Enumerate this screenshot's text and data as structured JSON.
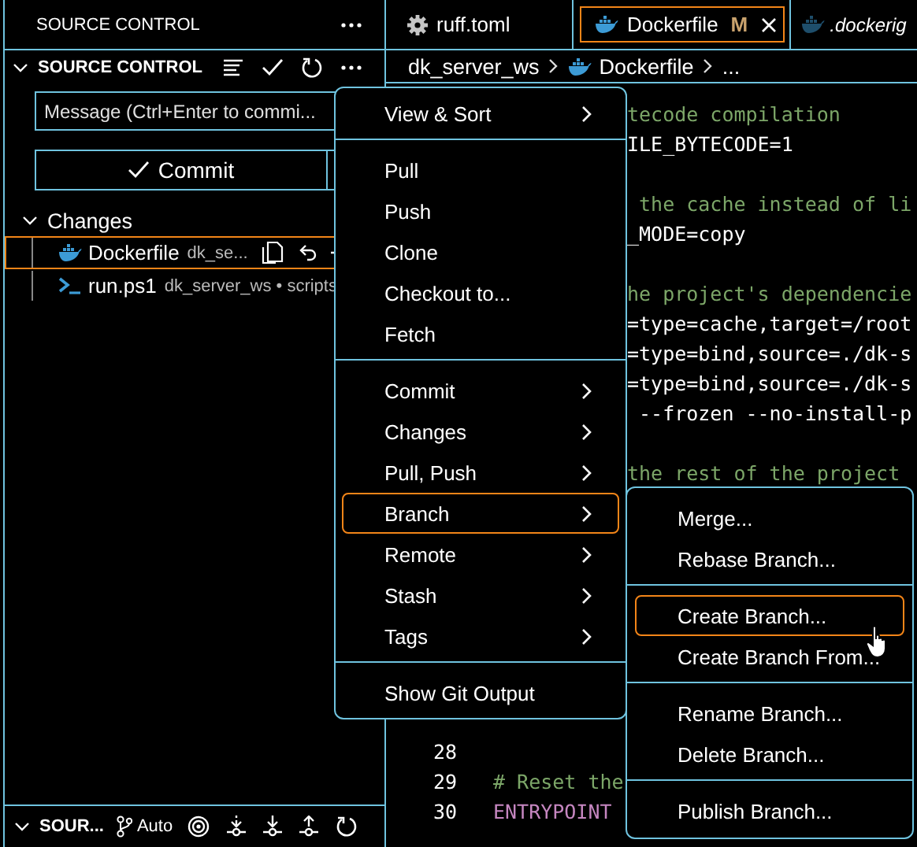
{
  "sidebar": {
    "title": "SOURCE CONTROL",
    "section": {
      "title": "SOURCE CONTROL",
      "expanded": true
    },
    "message": {
      "placeholder": "Message (Ctrl+Enter to commi..."
    },
    "commit_button": "Commit",
    "changes": {
      "label": "Changes",
      "expanded": true,
      "files": [
        {
          "name": "Dockerfile",
          "path": "dk_se...",
          "kind": "docker",
          "selected": true
        },
        {
          "name": "run.ps1",
          "path": "dk_server_ws • scripts",
          "kind": "powershell",
          "selected": false
        }
      ]
    },
    "bottom_section": {
      "title": "SOUR...",
      "expanded": true,
      "branch_mode": "Auto"
    }
  },
  "tabs": [
    {
      "label": "ruff.toml",
      "kind": "settings",
      "selected": false,
      "preview": false
    },
    {
      "label": "Dockerfile",
      "kind": "docker",
      "selected": true,
      "preview": false,
      "badge": "M"
    },
    {
      "label": ".dockerig",
      "kind": "docker",
      "selected": false,
      "preview": true
    }
  ],
  "breadcrumb": [
    {
      "label": "dk_server_ws",
      "kind": "folder"
    },
    {
      "label": "Dockerfile",
      "kind": "docker"
    },
    {
      "label": "...",
      "kind": "symbol"
    }
  ],
  "editor": {
    "top_lines": [
      {
        "kind": "comment",
        "text": "tecode compilation"
      },
      {
        "kind": "code",
        "text": "ILE_BYTECODE=1"
      },
      {
        "kind": "blank"
      },
      {
        "kind": "comment",
        "text": " the cache instead of li"
      },
      {
        "kind": "code",
        "text": "_MODE=copy"
      },
      {
        "kind": "blank"
      },
      {
        "kind": "comment",
        "text": "he project's dependencie"
      },
      {
        "kind": "code",
        "text": "=type=cache,target=/root"
      },
      {
        "kind": "code",
        "text": "=type=bind,source=./dk-s"
      },
      {
        "kind": "code",
        "text": "=type=bind,source=./dk-s"
      },
      {
        "kind": "code",
        "text": " --frozen --no-install-p"
      },
      {
        "kind": "blank"
      },
      {
        "kind": "comment",
        "text": "the rest of the project"
      }
    ],
    "bottom_lines": [
      {
        "number": "28",
        "kind": "blank"
      },
      {
        "number": "29",
        "kind": "comment",
        "text": "# Reset the"
      },
      {
        "number": "30",
        "kind": "keyword",
        "text": "ENTRYPOINT"
      }
    ]
  },
  "context_menu": {
    "items": [
      {
        "kind": "item",
        "label": "View & Sort",
        "submenu": true,
        "selected": false
      },
      {
        "kind": "separator"
      },
      {
        "kind": "item",
        "label": "Pull",
        "submenu": false,
        "selected": false
      },
      {
        "kind": "item",
        "label": "Push",
        "submenu": false,
        "selected": false
      },
      {
        "kind": "item",
        "label": "Clone",
        "submenu": false,
        "selected": false
      },
      {
        "kind": "item",
        "label": "Checkout to...",
        "submenu": false,
        "selected": false
      },
      {
        "kind": "item",
        "label": "Fetch",
        "submenu": false,
        "selected": false
      },
      {
        "kind": "separator"
      },
      {
        "kind": "item",
        "label": "Commit",
        "submenu": true,
        "selected": false
      },
      {
        "kind": "item",
        "label": "Changes",
        "submenu": true,
        "selected": false
      },
      {
        "kind": "item",
        "label": "Pull, Push",
        "submenu": true,
        "selected": false
      },
      {
        "kind": "item",
        "label": "Branch",
        "submenu": true,
        "selected": true
      },
      {
        "kind": "item",
        "label": "Remote",
        "submenu": true,
        "selected": false
      },
      {
        "kind": "item",
        "label": "Stash",
        "submenu": true,
        "selected": false
      },
      {
        "kind": "item",
        "label": "Tags",
        "submenu": true,
        "selected": false
      },
      {
        "kind": "separator"
      },
      {
        "kind": "item",
        "label": "Show Git Output",
        "submenu": false,
        "selected": false
      }
    ]
  },
  "submenu": {
    "items": [
      {
        "kind": "item",
        "label": "Merge...",
        "selected": false
      },
      {
        "kind": "item",
        "label": "Rebase Branch...",
        "selected": false
      },
      {
        "kind": "separator"
      },
      {
        "kind": "item",
        "label": "Create Branch...",
        "selected": true
      },
      {
        "kind": "item",
        "label": "Create Branch From...",
        "selected": false
      },
      {
        "kind": "separator"
      },
      {
        "kind": "item",
        "label": "Rename Branch...",
        "selected": false
      },
      {
        "kind": "item",
        "label": "Delete Branch...",
        "selected": false
      },
      {
        "kind": "separator"
      },
      {
        "kind": "item",
        "label": "Publish Branch...",
        "selected": false
      }
    ]
  }
}
